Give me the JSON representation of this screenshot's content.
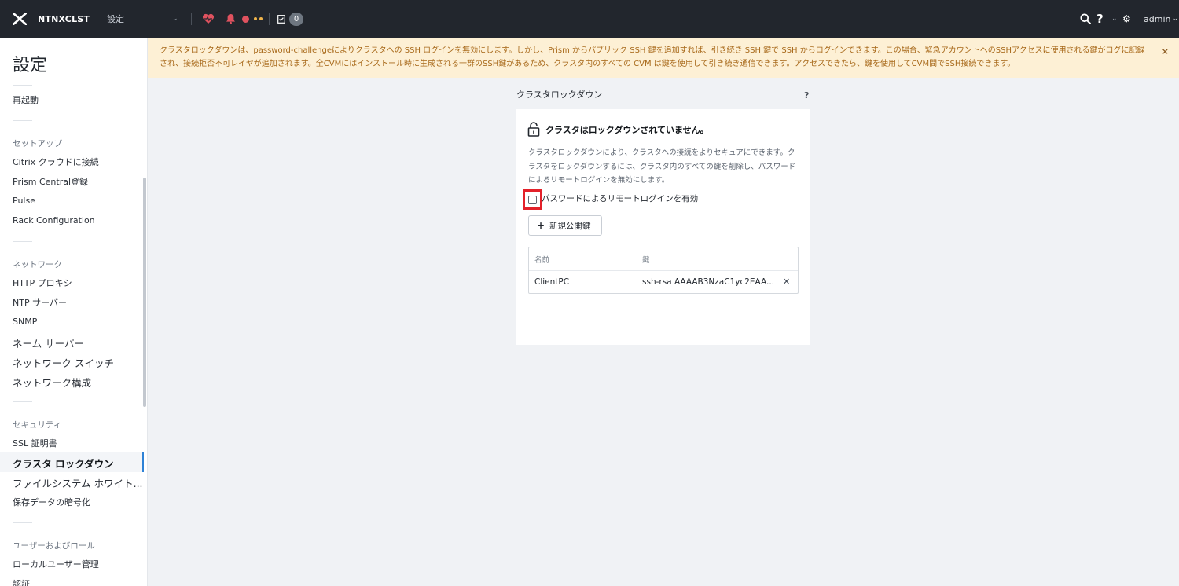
{
  "topbar": {
    "cluster_name": "NTNXCLST",
    "page_selector": "設定",
    "task_count": "0",
    "user": "admin"
  },
  "sidebar": {
    "title": "設定",
    "items_top": [
      {
        "label": "再起動"
      }
    ],
    "sections": [
      {
        "heading": "セットアップ",
        "items": [
          "Citrix クラウドに接続",
          "Prism Central登録",
          "Pulse",
          "Rack Configuration"
        ]
      },
      {
        "heading": "ネットワーク",
        "items": [
          "HTTP プロキシ",
          "NTP サーバー",
          "SNMP",
          "ネーム サーバー",
          "ネットワーク スイッチ",
          "ネットワーク構成"
        ]
      },
      {
        "heading": "セキュリティ",
        "items": [
          "SSL 証明書",
          "クラスタ ロックダウン",
          "ファイルシステム ホワイト...",
          "保存データの暗号化"
        ]
      },
      {
        "heading": "ユーザーおよびロール",
        "items": [
          "ローカルユーザー管理",
          "認証"
        ]
      }
    ],
    "active_item": "クラスタ ロックダウン"
  },
  "banner": {
    "text": "クラスタロックダウンは、password-challengeによりクラスタへの SSH ログインを無効にします。しかし、Prism からパブリック SSH 鍵を追加すれば、引き続き SSH 鍵で SSH からログインできます。この場合、緊急アカウントへのSSHアクセスに使用される鍵がログに記録され、接続拒否不可レイヤが追加されます。全CVMにはインストール時に生成される一群のSSH鍵があるため、クラスタ内のすべての CVM は鍵を使用して引き続き通信できます。アクセスできたら、鍵を使用してCVM間でSSH接続できます。",
    "close": "×"
  },
  "panel": {
    "title": "クラスタロックダウン",
    "help": "?",
    "status": "クラスタはロックダウンされていません。",
    "description": "クラスタロックダウンにより、クラスタへの接続をよりセキュアにできます。クラスタをロックダウンするには、クラスタ内のすべての鍵を削除し、パスワードによるリモートログインを無効にします。",
    "checkbox_label": "パスワードによるリモートログインを有効",
    "checkbox_checked": false,
    "add_button": "新規公開鍵",
    "table": {
      "columns": [
        "名前",
        "鍵"
      ],
      "rows": [
        {
          "name": "ClientPC",
          "key": "ssh-rsa AAAAB3NzaC1yc2EAA..."
        }
      ]
    }
  },
  "colors": {
    "topbar": "#22262d",
    "banner_bg": "#fdf0d5",
    "banner_text": "#a8691a",
    "highlight": "#e3212a",
    "active_accent": "#2e82d6"
  }
}
